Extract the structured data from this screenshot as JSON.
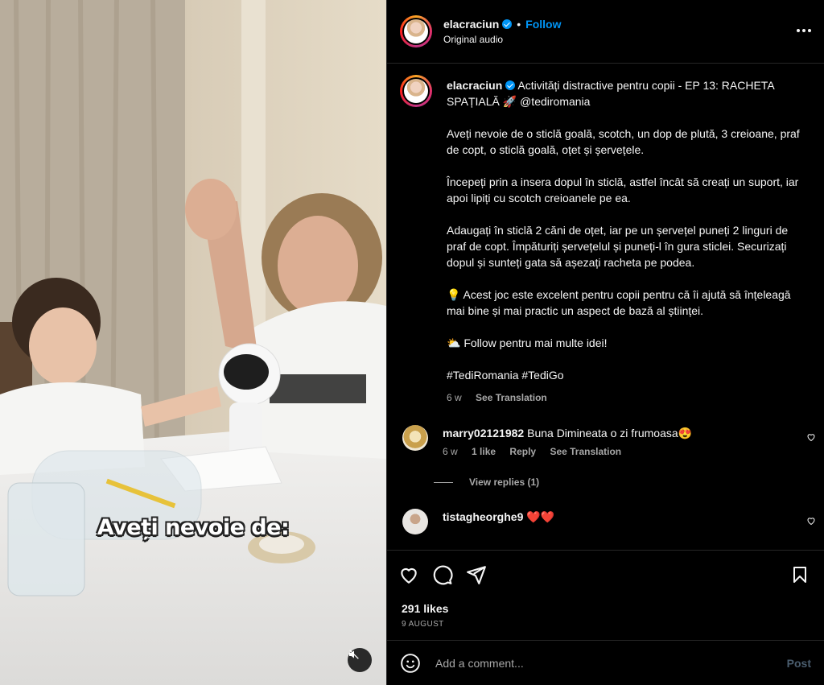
{
  "post": {
    "username": "elacraciun",
    "follow_label": "Follow",
    "audio": "Original audio",
    "more_icon": "more-horizontal-icon"
  },
  "video": {
    "overlay_text": "Aveți nevoie de:",
    "mute_icon": "speaker-muted-icon"
  },
  "caption": {
    "username": "elacraciun",
    "paragraphs": [
      "Activități distractive pentru copii - EP 13: RACHETA SPAȚIALĂ 🚀 @tediromania",
      "Aveți nevoie de o sticlă goală, scotch, un dop de plută, 3 creioane, praf de copt, o sticlă goală, oțet și șervețele.",
      "Începeți prin a insera dopul în sticlă, astfel încât să creați un suport, iar apoi lipiți cu scotch creioanele pe ea.",
      "Adaugați în sticlă 2 căni de oțet, iar pe un șervețel puneți 2 linguri de praf de copt. Împăturiți șervețelul și puneți-l în gura sticlei. Securizați dopul și sunteți gata să așezați racheta pe podea.",
      "💡 Acest joc este excelent pentru copii pentru că îi ajută să înțeleagă mai bine și mai practic un aspect de bază al științei.",
      "⛅ Follow pentru mai multe idei!",
      "#TediRomania #TediGo"
    ],
    "time": "6 w",
    "see_translation": "See Translation"
  },
  "comments": [
    {
      "username": "marry02121982",
      "text": "Buna Dimineata o zi frumoasa😍",
      "time": "6 w",
      "likes": "1 like",
      "reply": "Reply",
      "see_translation": "See Translation",
      "view_replies": "View replies (1)"
    },
    {
      "username": "tistagheorghe9",
      "text": "❤️❤️"
    }
  ],
  "actions": {
    "like_icon": "heart-icon",
    "comment_icon": "comment-icon",
    "share_icon": "send-icon",
    "save_icon": "bookmark-icon",
    "likes": "291 likes",
    "date": "9 AUGUST"
  },
  "add_comment": {
    "placeholder": "Add a comment...",
    "post_label": "Post",
    "emoji_icon": "emoji-icon"
  }
}
